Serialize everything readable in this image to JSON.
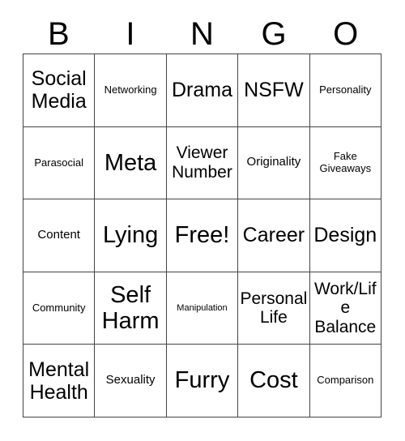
{
  "card": {
    "title": "BINGO",
    "header_letters": [
      "B",
      "I",
      "N",
      "G",
      "O"
    ],
    "grid_size": "5x5",
    "free_space": "Free!",
    "border_color": "#444444",
    "text_color": "#000000",
    "background_color": "#ffffff",
    "cells": [
      {
        "text": "Social\nMedia",
        "size": "xl",
        "row": 1,
        "col": 1
      },
      {
        "text": "Networking",
        "size": "s",
        "row": 1,
        "col": 2
      },
      {
        "text": "Drama",
        "size": "xl",
        "row": 1,
        "col": 3
      },
      {
        "text": "NSFW",
        "size": "xl",
        "row": 1,
        "col": 4
      },
      {
        "text": "Personality",
        "size": "s",
        "row": 1,
        "col": 5
      },
      {
        "text": "Parasocial",
        "size": "s",
        "row": 2,
        "col": 1
      },
      {
        "text": "Meta",
        "size": "xxl",
        "row": 2,
        "col": 2
      },
      {
        "text": "Viewer\nNumber",
        "size": "l",
        "row": 2,
        "col": 3
      },
      {
        "text": "Originality",
        "size": "m",
        "row": 2,
        "col": 4
      },
      {
        "text": "Fake\nGiveaways",
        "size": "s",
        "row": 2,
        "col": 5
      },
      {
        "text": "Content",
        "size": "m",
        "row": 3,
        "col": 1
      },
      {
        "text": "Lying",
        "size": "xxl",
        "row": 3,
        "col": 2
      },
      {
        "text": "Free!",
        "size": "xxl",
        "row": 3,
        "col": 3
      },
      {
        "text": "Career",
        "size": "xl",
        "row": 3,
        "col": 4
      },
      {
        "text": "Design",
        "size": "xl",
        "row": 3,
        "col": 5
      },
      {
        "text": "Community",
        "size": "s",
        "row": 4,
        "col": 1
      },
      {
        "text": "Self\nHarm",
        "size": "xxl",
        "row": 4,
        "col": 2
      },
      {
        "text": "Manipulation",
        "size": "xs",
        "row": 4,
        "col": 3
      },
      {
        "text": "Personal\nLife",
        "size": "l",
        "row": 4,
        "col": 4
      },
      {
        "text": "Work/Life\nBalance",
        "size": "l",
        "row": 4,
        "col": 5
      },
      {
        "text": "Mental\nHealth",
        "size": "xl",
        "row": 5,
        "col": 1
      },
      {
        "text": "Sexuality",
        "size": "m",
        "row": 5,
        "col": 2
      },
      {
        "text": "Furry",
        "size": "xxl",
        "row": 5,
        "col": 3
      },
      {
        "text": "Cost",
        "size": "xxl",
        "row": 5,
        "col": 4
      },
      {
        "text": "Comparison",
        "size": "s",
        "row": 5,
        "col": 5
      }
    ]
  }
}
